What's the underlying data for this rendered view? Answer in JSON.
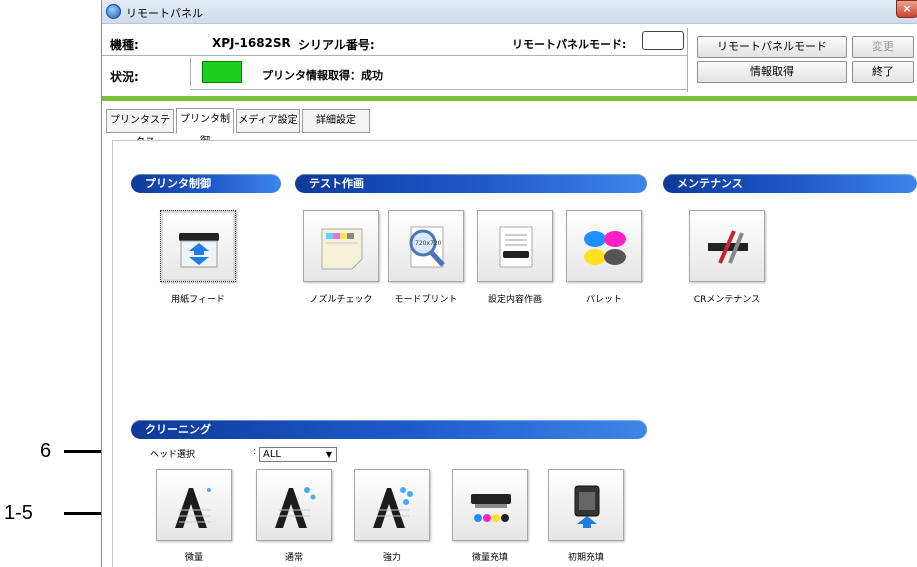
{
  "window": {
    "title": "リモートパネル",
    "close_label": "×"
  },
  "info": {
    "model_label": "機種:",
    "model_value": "XPJ-1682SR",
    "serial_label": "シリアル番号:",
    "serial_value": "",
    "remote_mode_label": "リモートパネルモード:",
    "remote_mode_value": "",
    "status_label": "状況:",
    "status_value": "プリンタ情報取得：成功",
    "status_color": "#1ed01e"
  },
  "buttons": {
    "remote_panel_mode": "リモートパネルモード",
    "change": "変更",
    "get_info": "情報取得",
    "exit": "終了"
  },
  "tabs": [
    {
      "label": "プリンタステータス"
    },
    {
      "label": "プリンタ制御"
    },
    {
      "label": "メディア設定"
    },
    {
      "label": "詳細設定"
    }
  ],
  "sections": {
    "printer_control": "プリンタ制御",
    "test_print": "テスト作画",
    "maintenance": "メンテナンス",
    "cleaning": "クリーニング"
  },
  "printer_control_items": [
    {
      "label": "用紙フィード",
      "icon": "paper-feed-icon"
    }
  ],
  "test_print_items": [
    {
      "label": "ノズルチェック",
      "icon": "nozzle-check-icon"
    },
    {
      "label": "モードプリント",
      "icon": "mode-print-icon"
    },
    {
      "label": "設定内容作画",
      "icon": "settings-print-icon"
    },
    {
      "label": "パレット",
      "icon": "palette-icon"
    }
  ],
  "maintenance_items": [
    {
      "label": "CRメンテナンス",
      "icon": "cr-maintenance-icon"
    }
  ],
  "cleaning": {
    "head_select_label": "ヘッド選択",
    "head_select_value": "ALL",
    "items": [
      {
        "label": "微量",
        "icon": "cleaning-light-icon"
      },
      {
        "label": "通常",
        "icon": "cleaning-normal-icon"
      },
      {
        "label": "強力",
        "icon": "cleaning-strong-icon"
      },
      {
        "label": "微量充填",
        "icon": "ink-fill-light-icon"
      },
      {
        "label": "初期充填",
        "icon": "initial-fill-icon"
      }
    ]
  },
  "callouts": [
    {
      "label": "6"
    },
    {
      "label": "1-5"
    }
  ],
  "colors": {
    "accent_green": "#77c13b",
    "section_blue": "#1f5bcc"
  }
}
